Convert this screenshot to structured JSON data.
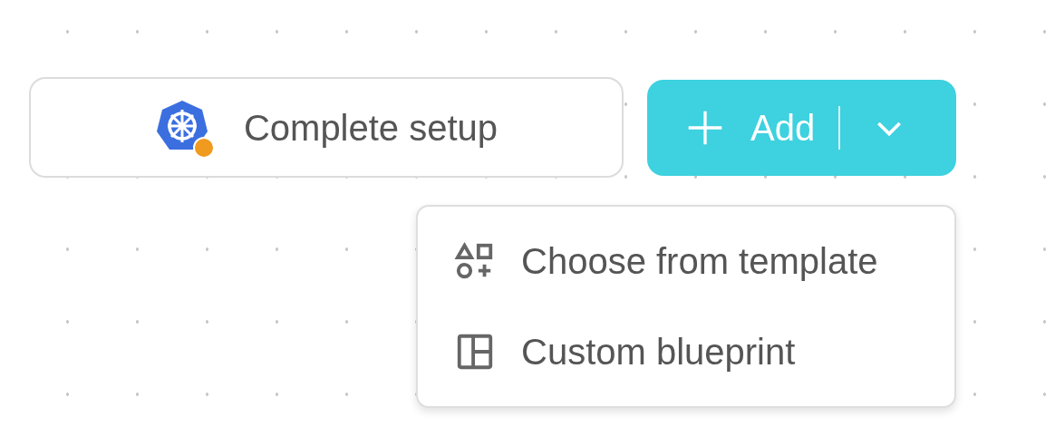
{
  "setup_button": {
    "label": "Complete setup"
  },
  "add_button": {
    "label": "Add",
    "expanded": true
  },
  "menu": {
    "items": [
      {
        "kind": "template",
        "label": "Choose from template"
      },
      {
        "kind": "blueprint",
        "label": "Custom blueprint"
      }
    ]
  }
}
